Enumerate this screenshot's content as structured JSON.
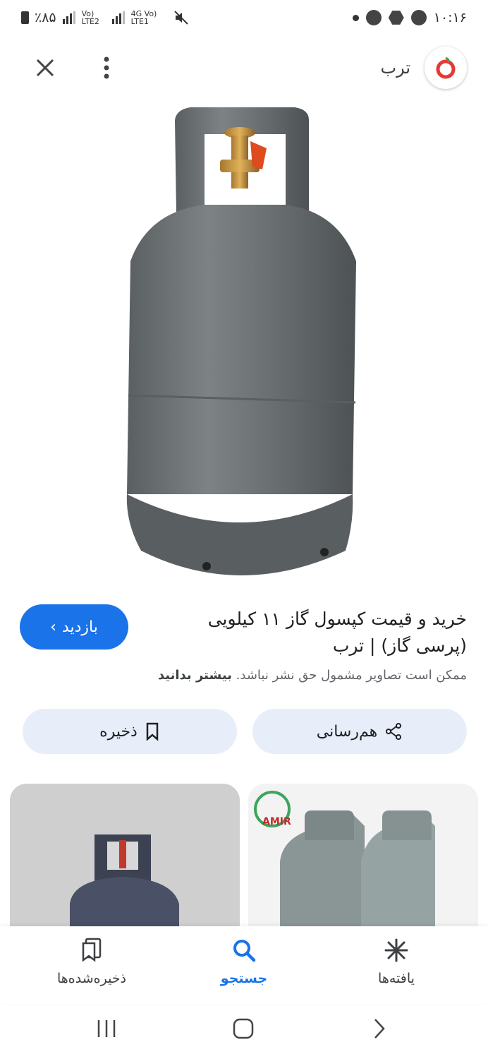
{
  "status_bar": {
    "battery": "٪۸۵",
    "network_1": "Vo) LTE2",
    "network_2": "4G Vo) LTE1",
    "time": "۱۰:۱۶"
  },
  "header": {
    "site_name": "ترب"
  },
  "result": {
    "title": "خرید و قیمت کپسول گاز ۱۱ کیلویی (پرسی گاز) | ترب",
    "visit_label": "بازدید",
    "notice_text": "ممکن است تصاویر مشمول حق نشر نباشد.",
    "notice_link": "بیشتر بدانید"
  },
  "actions": {
    "share_label": "هم‌رسانی",
    "save_label": "ذخیره"
  },
  "thumbnails": {
    "right_brand": "AMIR"
  },
  "bottom_nav": {
    "saved_label": "ذخیره‌شده‌ها",
    "search_label": "جستجو",
    "discover_label": "یافته‌ها"
  },
  "colors": {
    "accent": "#1a73e8",
    "chip_bg": "#e8eef9",
    "logo_red": "#e53935"
  }
}
